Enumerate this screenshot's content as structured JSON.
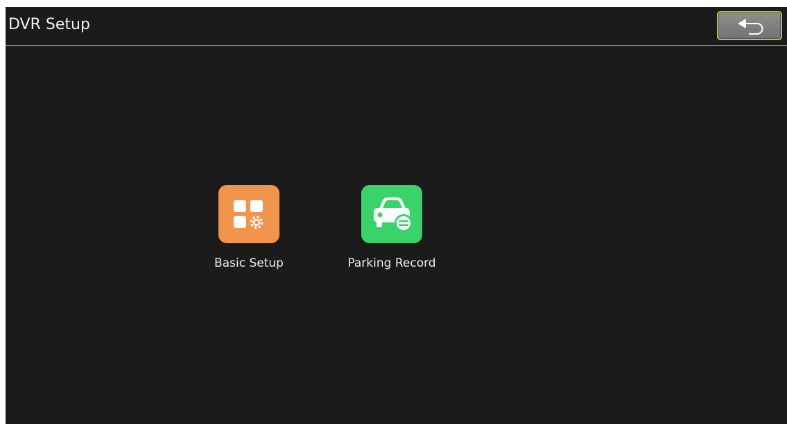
{
  "header": {
    "title": "DVR Setup",
    "back_icon": "back-arrow-icon"
  },
  "menu": {
    "items": [
      {
        "label": "Basic Setup",
        "icon": "apps-gear-icon",
        "color": "#f0954b"
      },
      {
        "label": "Parking Record",
        "icon": "car-icon",
        "color": "#39d36a"
      }
    ]
  },
  "colors": {
    "background": "#1b1b1b",
    "header_divider": "#9a9a9a",
    "back_button_border": "#b6c82d",
    "text": "#f2f2f2"
  }
}
